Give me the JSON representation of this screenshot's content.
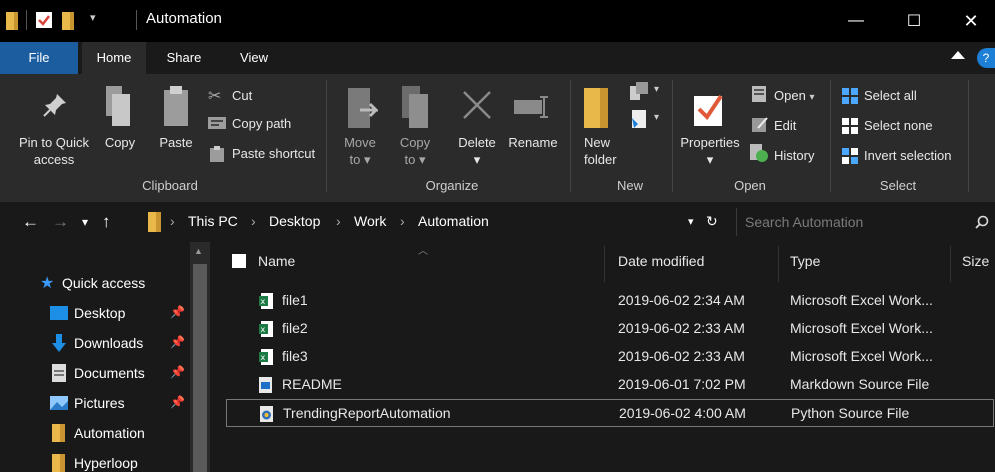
{
  "window": {
    "title": "Automation",
    "controls": {
      "minimize": "—",
      "maximize": "☐",
      "close": "✕"
    }
  },
  "tabs": [
    {
      "label": "File"
    },
    {
      "label": "Home"
    },
    {
      "label": "Share"
    },
    {
      "label": "View"
    }
  ],
  "ribbon": {
    "clipboard": {
      "group_label": "Clipboard",
      "pin_label_1": "Pin to Quick",
      "pin_label_2": "access",
      "copy": "Copy",
      "paste": "Paste",
      "cut": "Cut",
      "copy_path": "Copy path",
      "paste_shortcut": "Paste shortcut"
    },
    "organize": {
      "group_label": "Organize",
      "move_to_1": "Move",
      "move_to_2": "to",
      "copy_to_1": "Copy",
      "copy_to_2": "to",
      "delete": "Delete",
      "rename": "Rename"
    },
    "new": {
      "group_label": "New",
      "new_folder_1": "New",
      "new_folder_2": "folder"
    },
    "open": {
      "group_label": "Open",
      "properties": "Properties",
      "open": "Open",
      "edit": "Edit",
      "history": "History"
    },
    "select": {
      "group_label": "Select",
      "select_all": "Select all",
      "select_none": "Select none",
      "invert_selection": "Invert selection"
    }
  },
  "address": {
    "breadcrumbs": [
      "This PC",
      "Desktop",
      "Work",
      "Automation"
    ],
    "search_placeholder": "Search Automation"
  },
  "navpane": {
    "items": [
      {
        "label": "Quick access",
        "icon": "star-icon",
        "pinned": false
      },
      {
        "label": "Desktop",
        "icon": "desktop-folder-icon",
        "pinned": true
      },
      {
        "label": "Downloads",
        "icon": "download-arrow-icon",
        "pinned": true
      },
      {
        "label": "Documents",
        "icon": "documents-icon",
        "pinned": true
      },
      {
        "label": "Pictures",
        "icon": "pictures-icon",
        "pinned": true
      },
      {
        "label": "Automation",
        "icon": "folder-icon",
        "pinned": false
      },
      {
        "label": "Hyperloop",
        "icon": "folder-icon",
        "pinned": false
      }
    ]
  },
  "filelist": {
    "columns": {
      "name": "Name",
      "date": "Date modified",
      "type": "Type",
      "size": "Size"
    },
    "files": [
      {
        "name": "file1",
        "date": "2019-06-02 2:34 AM",
        "type": "Microsoft Excel Work...",
        "icon": "excel-file-icon",
        "selected": false
      },
      {
        "name": "file2",
        "date": "2019-06-02 2:33 AM",
        "type": "Microsoft Excel Work...",
        "icon": "excel-file-icon",
        "selected": false
      },
      {
        "name": "file3",
        "date": "2019-06-02 2:33 AM",
        "type": "Microsoft Excel Work...",
        "icon": "excel-file-icon",
        "selected": false
      },
      {
        "name": "README",
        "date": "2019-06-01 7:02 PM",
        "type": "Markdown Source File",
        "icon": "markdown-file-icon",
        "selected": false
      },
      {
        "name": "TrendingReportAutomation",
        "date": "2019-06-02 4:00 AM",
        "type": "Python Source File",
        "icon": "python-file-icon",
        "selected": true
      }
    ]
  },
  "colors": {
    "file_tab": "#1c5da0",
    "folder": "#e8b84a",
    "accent_blue": "#1e7fd6",
    "excel_green": "#1d7a44"
  }
}
